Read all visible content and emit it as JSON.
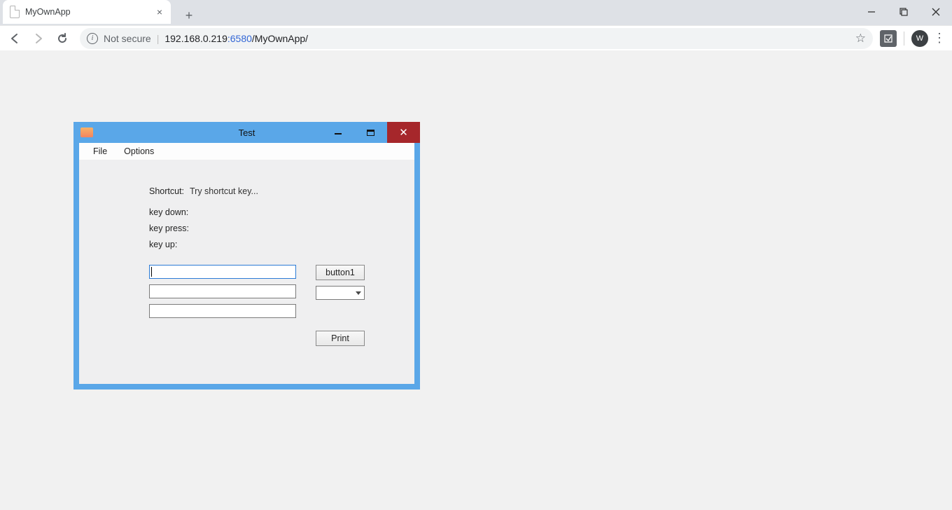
{
  "browser": {
    "tab_title": "MyOwnApp",
    "security_label": "Not secure",
    "url_host": "192.168.0.219",
    "url_port": ":6580",
    "url_path": "/MyOwnApp/",
    "avatar_initial": "W"
  },
  "app": {
    "title": "Test",
    "menu": {
      "file": "File",
      "options": "Options"
    },
    "labels": {
      "shortcut": "Shortcut:",
      "shortcut_hint": "Try shortcut key...",
      "keydown": "key down:",
      "keypress": "key press:",
      "keyup": "key up:"
    },
    "buttons": {
      "button1": "button1",
      "print": "Print"
    },
    "inputs": {
      "t1": "",
      "t2": "",
      "t3": ""
    },
    "combo_value": ""
  }
}
